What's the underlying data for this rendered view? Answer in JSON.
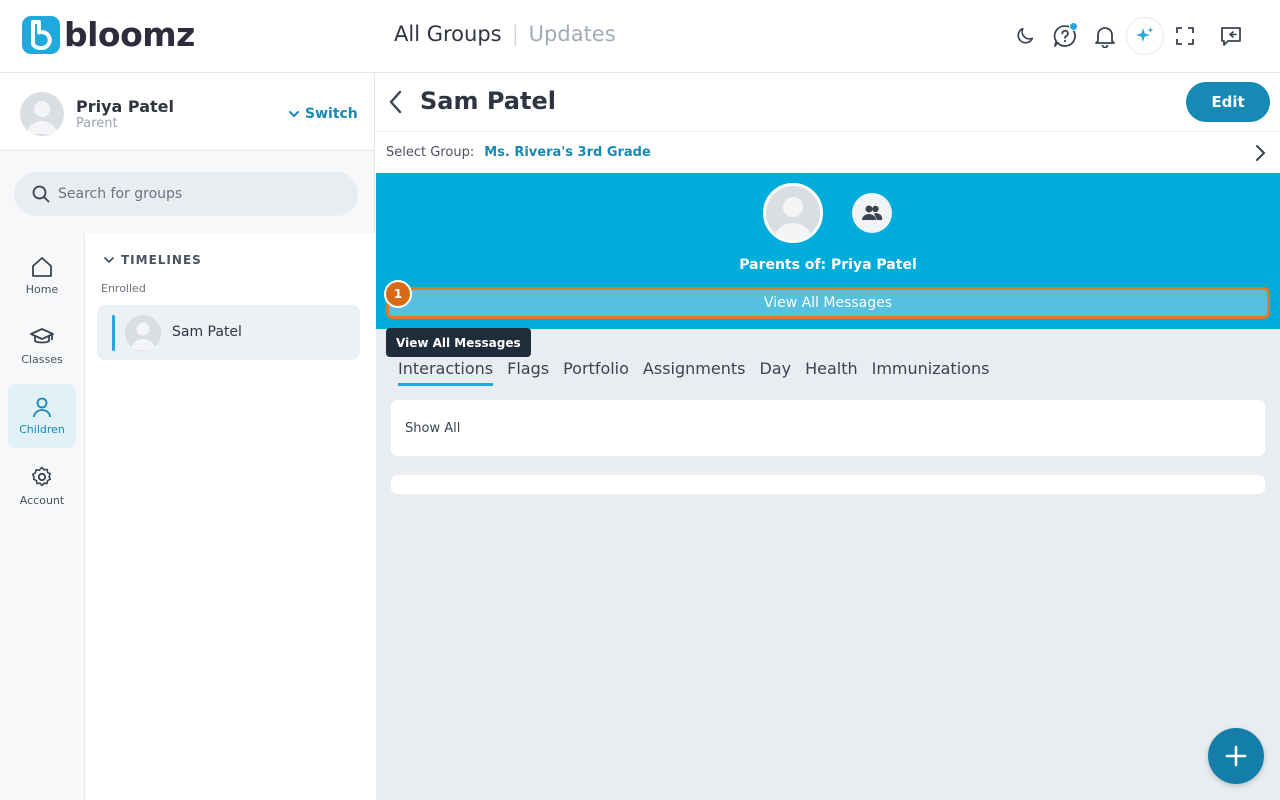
{
  "brand": {
    "logo_text": "bloomz",
    "logo_letter": "b"
  },
  "header": {
    "title_active": "All Groups",
    "separator": "|",
    "title_inactive": "Updates",
    "icons": [
      "moon-icon",
      "help-chat-icon",
      "bell-icon",
      "sparkle-icon",
      "fullscreen-icon",
      "collapse-panel-icon"
    ]
  },
  "profile": {
    "name": "Priya Patel",
    "role": "Parent",
    "switch_label": "Switch"
  },
  "search": {
    "placeholder": "Search for groups"
  },
  "nav": {
    "items": [
      {
        "label": "Home",
        "icon": "home-icon"
      },
      {
        "label": "Classes",
        "icon": "graduation-cap-icon"
      },
      {
        "label": "Children",
        "icon": "person-icon",
        "active": true
      },
      {
        "label": "Account",
        "icon": "gear-icon"
      }
    ]
  },
  "timelines": {
    "heading": "TIMELINES",
    "section": "Enrolled",
    "items": [
      {
        "name": "Sam Patel"
      }
    ]
  },
  "main": {
    "title": "Sam Patel",
    "edit_label": "Edit",
    "select_group_label": "Select Group:",
    "select_group_value": "Ms. Rivera's 3rd Grade",
    "parents_of": "Parents of: Priya Patel",
    "view_all_messages": "View All Messages",
    "step_badge": "1",
    "tooltip": "View All Messages",
    "tabs": [
      "Interactions",
      "Flags",
      "Portfolio",
      "Assignments",
      "Day",
      "Health",
      "Immunizations"
    ],
    "active_tab": "Interactions",
    "show_all": "Show All"
  },
  "colors": {
    "accent": "#1fa9dd",
    "banner": "#00acd9",
    "highlight": "#e07b2b",
    "primary_button": "#1789b5"
  }
}
